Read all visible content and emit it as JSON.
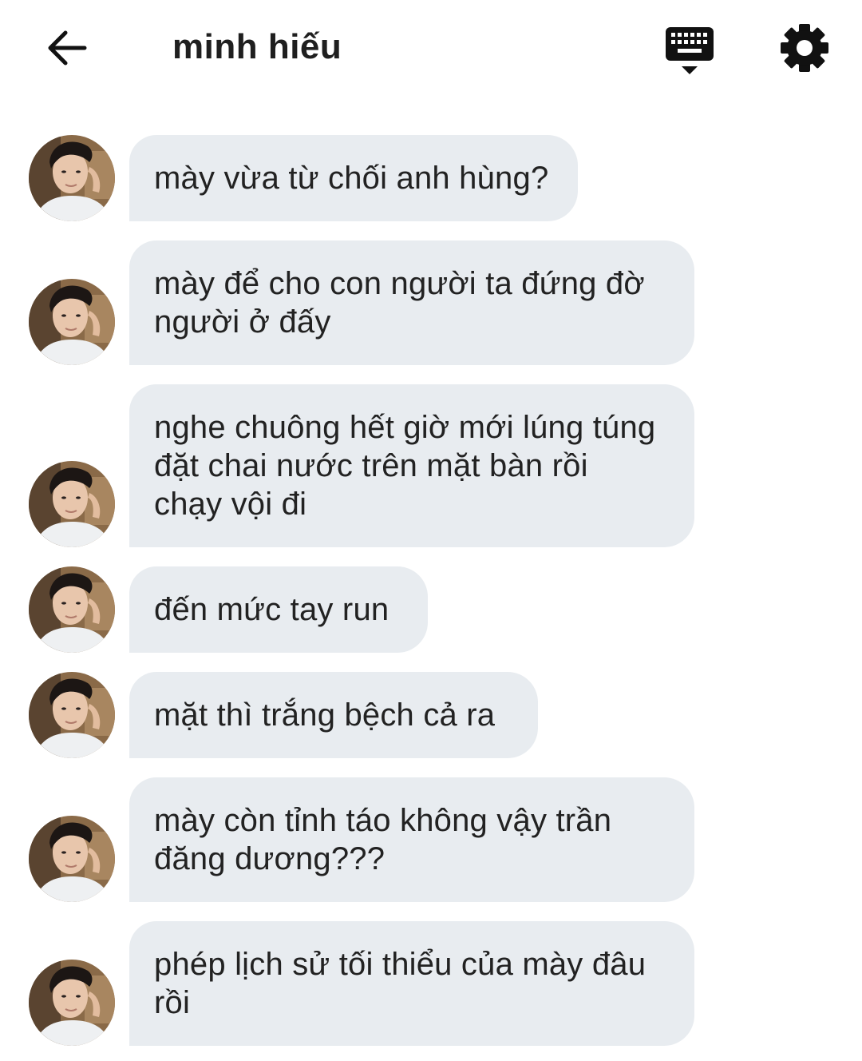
{
  "header": {
    "title": "minh hiếu",
    "icons": {
      "back": "arrow-left-icon",
      "keyboard": "keyboard-icon",
      "settings": "gear-icon"
    }
  },
  "messages": [
    {
      "text": "mày vừa từ chối anh hùng?"
    },
    {
      "text": "mày để cho con người ta đứng đờ\nngười ở đấy"
    },
    {
      "text": "nghe chuông hết giờ mới lúng túng\nđặt chai nước trên mặt bàn rồi\nchạy vội đi"
    },
    {
      "text": "đến mức tay run"
    },
    {
      "text": "mặt thì trắng bệch cả ra"
    },
    {
      "text": "mày còn tỉnh táo không vậy trần\nđăng dương???"
    },
    {
      "text": "phép lịch sử tối thiểu của mày đâu\nrồi"
    }
  ],
  "colors": {
    "bubble": "#e8ecf0",
    "icon": "#111111",
    "background": "#ffffff"
  }
}
